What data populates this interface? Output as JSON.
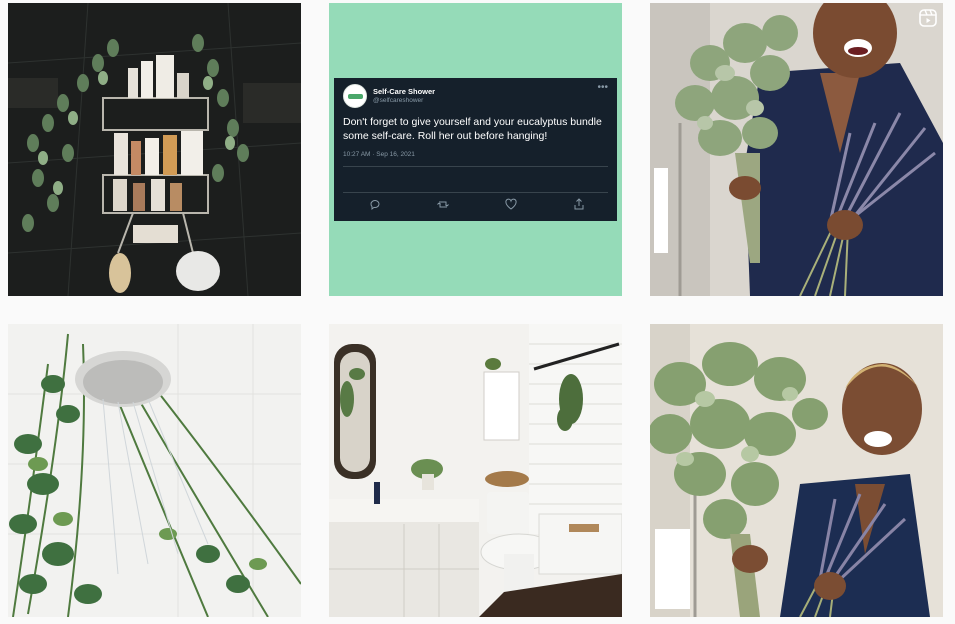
{
  "grid": {
    "posts": [
      {
        "name": "shower-caddy-eucalyptus",
        "type": "photo"
      },
      {
        "name": "tweet-screenshot",
        "type": "photo"
      },
      {
        "name": "woman-eucalyptus-lavender",
        "type": "reel"
      },
      {
        "name": "rosemary-showerhead",
        "type": "photo"
      },
      {
        "name": "bathroom-eucalyptus",
        "type": "photo"
      },
      {
        "name": "woman-eucalyptus-lavender-2",
        "type": "photo"
      }
    ]
  },
  "tweet": {
    "display_name": "Self-Care Shower",
    "handle": "@selfcareshower",
    "text": "Don't forget to give yourself and your eucalyptus bundle some self-care. Roll her out before hanging!",
    "timestamp": "10:27 AM · Sep 16, 2021",
    "icons": [
      "reply-icon",
      "retweet-icon",
      "like-icon",
      "share-icon"
    ]
  },
  "colors": {
    "page_bg": "#fafafa",
    "tweet_bg": "#15202b",
    "mint_bg": "#95dbb8",
    "tweet_muted": "#8899a6"
  }
}
